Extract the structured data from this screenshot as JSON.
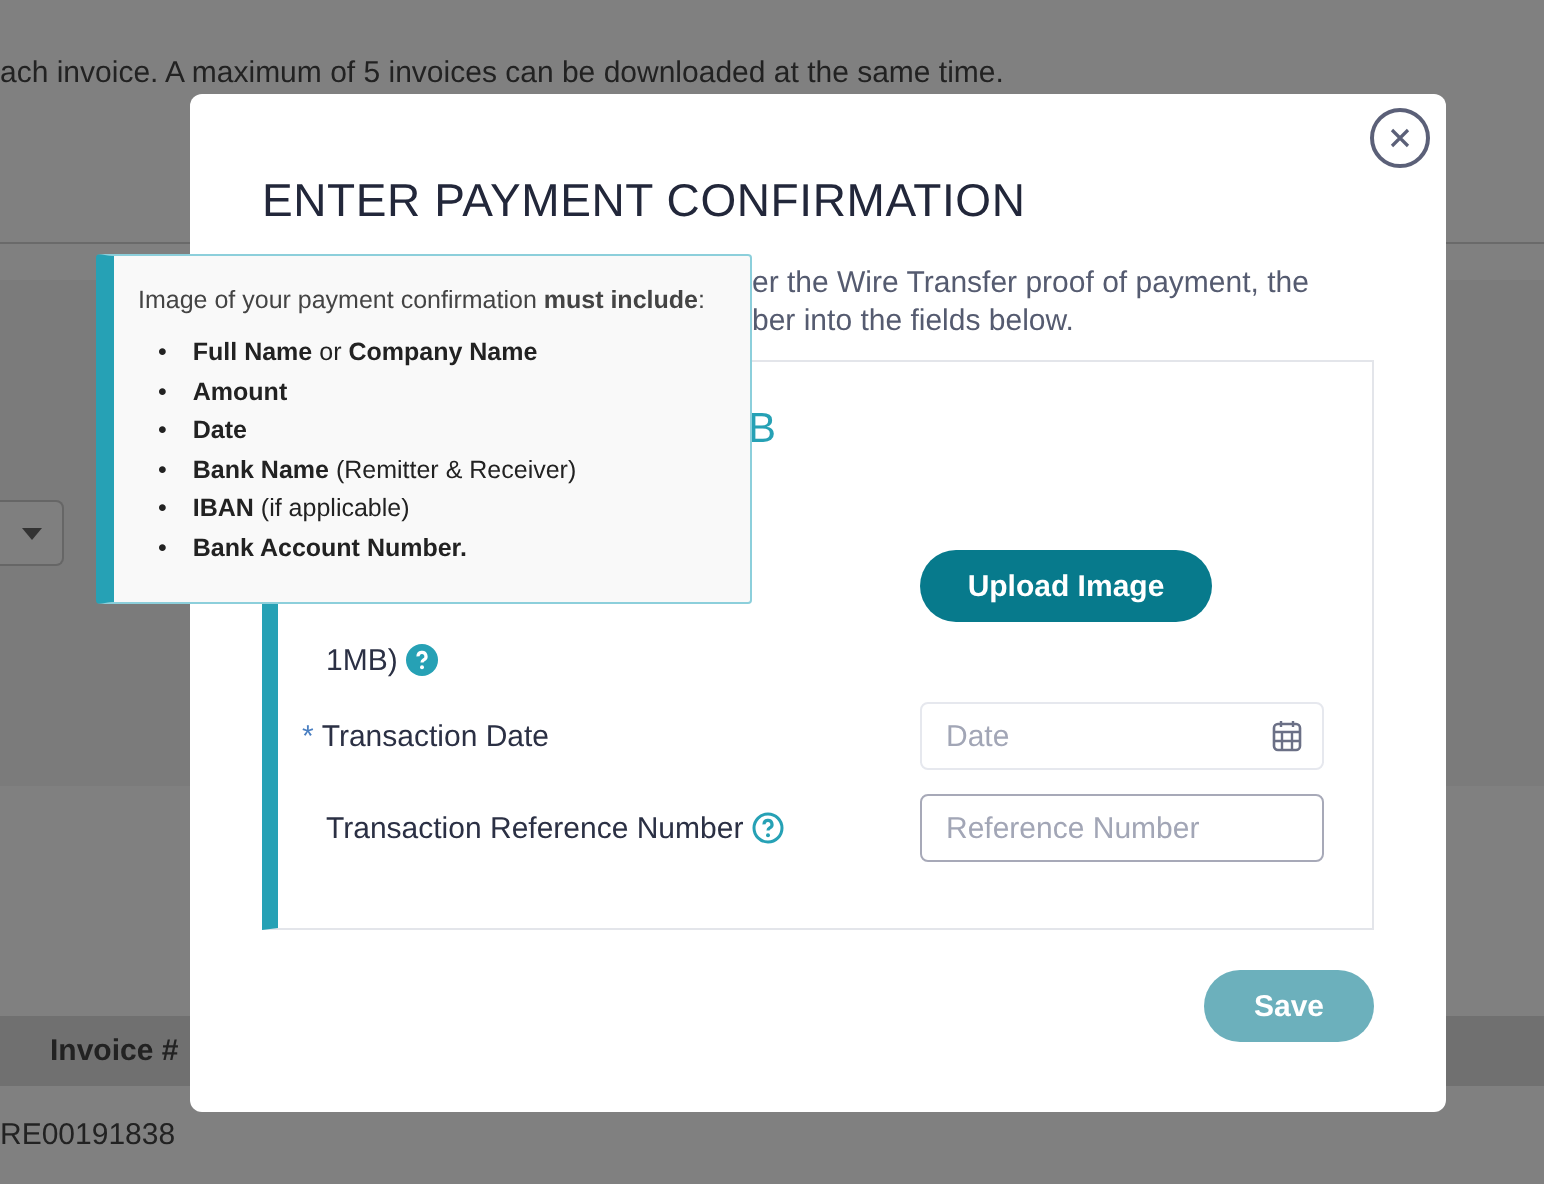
{
  "background": {
    "notice": "ach invoice. A maximum of 5 invoices can be downloaded at the same time.",
    "table": {
      "columns": [
        "Invoice #"
      ],
      "rows": [
        [
          "RE00191838"
        ]
      ]
    }
  },
  "modal": {
    "title": "ENTER PAYMENT CONFIRMATION",
    "description": [
      "er the Wire Transfer proof of payment, the",
      "ber into the fields below."
    ],
    "card": {
      "heading": "B",
      "fields": [
        {
          "kind": "upload",
          "label": "1MB)",
          "help": true,
          "button": "Upload Image"
        },
        {
          "kind": "date",
          "required_mark": "*",
          "label": "Transaction Date",
          "help": false,
          "placeholder": "Date"
        },
        {
          "kind": "text",
          "label": "Transaction Reference Number",
          "help": true,
          "placeholder": "Reference Number"
        }
      ]
    },
    "save": "Save"
  },
  "tooltip": {
    "bullet": "•",
    "intro": "Image of your payment confirmation **must include**:",
    "items": [
      "**Full Name** or **Company Name**",
      "**Amount**",
      "**Date**",
      "**Bank Name** (Remitter & Receiver)",
      "**IBAN** (if applicable)",
      "**Bank Account Number.**"
    ]
  }
}
